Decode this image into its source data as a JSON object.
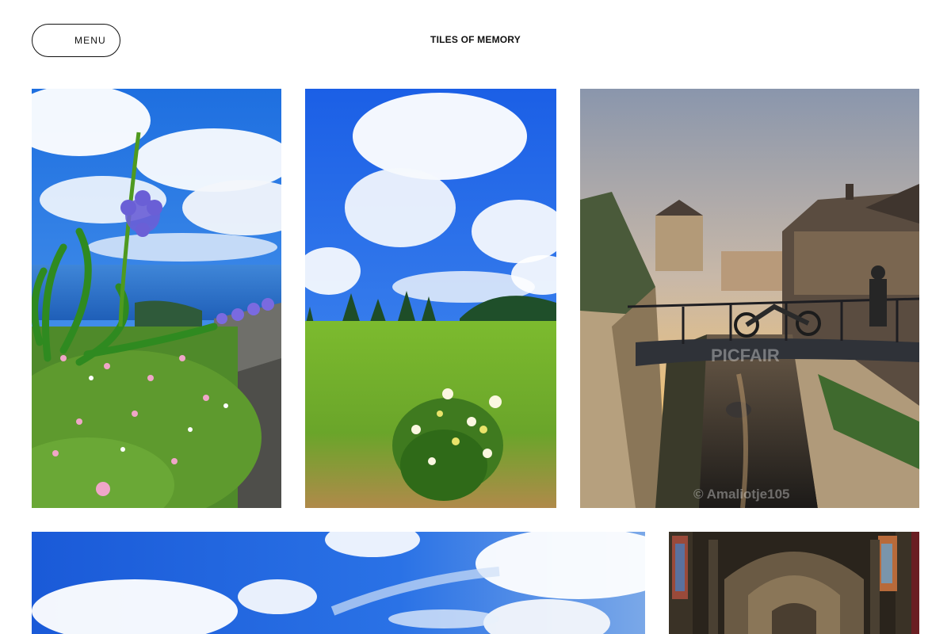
{
  "header": {
    "menu_label": "MENU",
    "site_title": "TILES OF MEMORY"
  },
  "gallery": {
    "tiles": [
      {
        "subject": "agapanthus flower over ocean cliff"
      },
      {
        "subject": "meadow with hydrangea and pine trees"
      },
      {
        "subject": "canal with bridge and motorbike at sunset",
        "watermark_brand": "PICFAIR",
        "watermark_credit": "© Amaliotje105"
      },
      {
        "subject": "blue sky with white clouds"
      },
      {
        "subject": "cathedral interior with stained glass"
      }
    ]
  }
}
